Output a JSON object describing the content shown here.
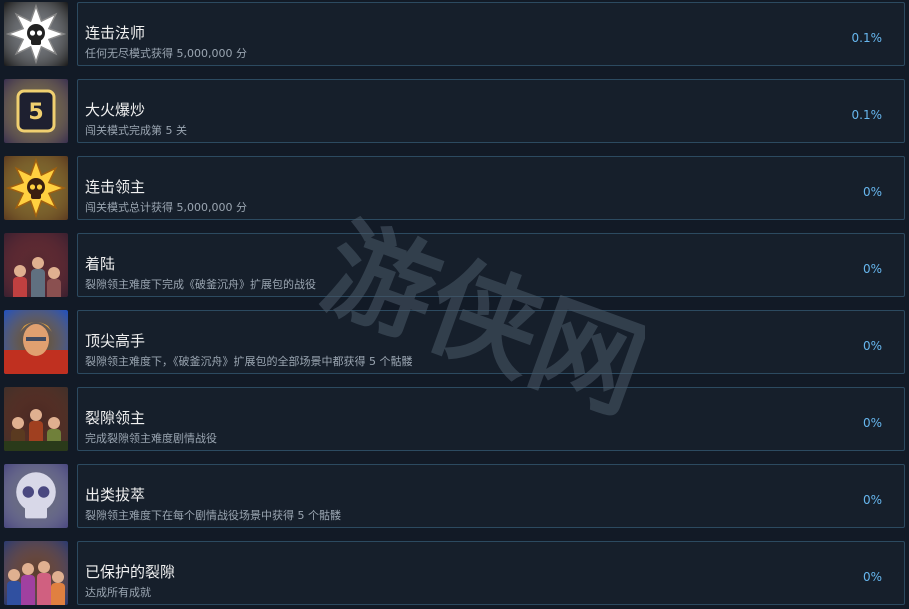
{
  "achievements": [
    {
      "title": "连击法师",
      "desc": "任何无尽模式获得 5,000,000 分",
      "pct": "0.1%",
      "icon": "silver-star-skull-icon",
      "colors": [
        "#1a1a1a",
        "#ffffff",
        "#4a3a40"
      ]
    },
    {
      "title": "大火爆炒",
      "desc": "闯关模式完成第 5 关",
      "pct": "0.1%",
      "icon": "level-5-badge-icon",
      "colors": [
        "#3a3050",
        "#f0d070",
        "#1e2030"
      ]
    },
    {
      "title": "连击领主",
      "desc": "闯关模式总计获得 5,000,000 分",
      "pct": "0%",
      "icon": "gold-star-skull-icon",
      "colors": [
        "#5a3a20",
        "#ffd040",
        "#2a1a10"
      ]
    },
    {
      "title": "着陆",
      "desc": "裂隙领主难度下完成《破釜沉舟》扩展包的战役",
      "pct": "0%",
      "icon": "heroes-landing-icon",
      "colors": [
        "#3a2030",
        "#c04040",
        "#607080"
      ]
    },
    {
      "title": "顶尖高手",
      "desc": "裂隙领主难度下，《破釜沉舟》扩展包的全部场景中都获得 5 个骷髅",
      "pct": "0%",
      "icon": "hero-portrait-icon",
      "colors": [
        "#2050c0",
        "#e0a040",
        "#c02020"
      ]
    },
    {
      "title": "裂隙领主",
      "desc": "完成裂隙领主难度剧情战役",
      "pct": "0%",
      "icon": "rift-lord-army-icon",
      "colors": [
        "#40302a",
        "#a04020",
        "#70803a"
      ]
    },
    {
      "title": "出类拔萃",
      "desc": "裂隙领主难度下在每个剧情战役场景中获得 5 个骷髅",
      "pct": "0%",
      "icon": "purple-skull-icon",
      "colors": [
        "#4a4880",
        "#d8d8e8",
        "#2a2850"
      ]
    },
    {
      "title": "已保护的裂隙",
      "desc": "达成所有成就",
      "pct": "0%",
      "icon": "heroes-group-icon",
      "colors": [
        "#2a3a70",
        "#e08040",
        "#a040a0"
      ]
    }
  ],
  "watermark": {
    "text": "游侠网",
    "color": "#4a5a68"
  }
}
